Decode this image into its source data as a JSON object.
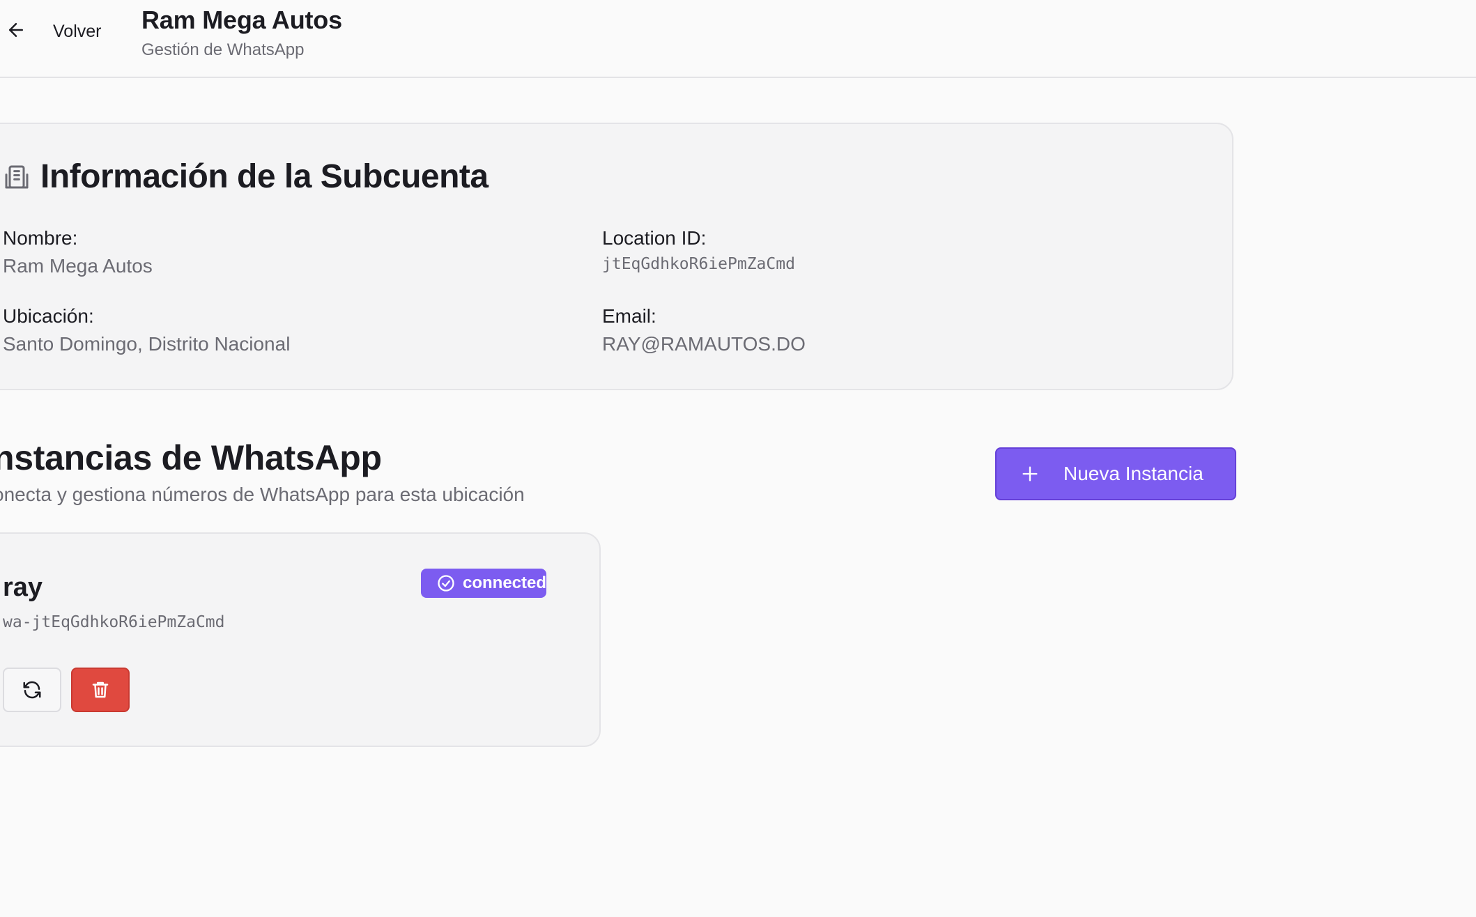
{
  "header": {
    "back_label": "Volver",
    "title": "Ram Mega Autos",
    "subtitle": "Gestión de WhatsApp"
  },
  "info_card": {
    "title": "Información de la Subcuenta",
    "icon": "building-icon",
    "fields": {
      "nombre": {
        "label": "Nombre:",
        "value": "Ram Mega Autos"
      },
      "location_id": {
        "label": "Location ID:",
        "value": "jtEqGdhkoR6iePmZaCmd"
      },
      "ubicacion": {
        "label": "Ubicación:",
        "value": "Santo Domingo, Distrito Nacional"
      },
      "email": {
        "label": "Email:",
        "value": "RAY@RAMAUTOS.DO"
      }
    }
  },
  "instances": {
    "title": "nstancias de WhatsApp",
    "subtitle": "onecta y gestiona números de WhatsApp para esta ubicación",
    "new_button_label": "Nueva Instancia",
    "items": [
      {
        "name": "ray",
        "id": "wa-jtEqGdhkoR6iePmZaCmd",
        "status": "connected"
      }
    ]
  },
  "colors": {
    "accent": "#7c5cf0",
    "danger": "#e0493f",
    "background": "#fafafa",
    "card": "#f4f4f5",
    "muted_text": "#6b6b73"
  }
}
